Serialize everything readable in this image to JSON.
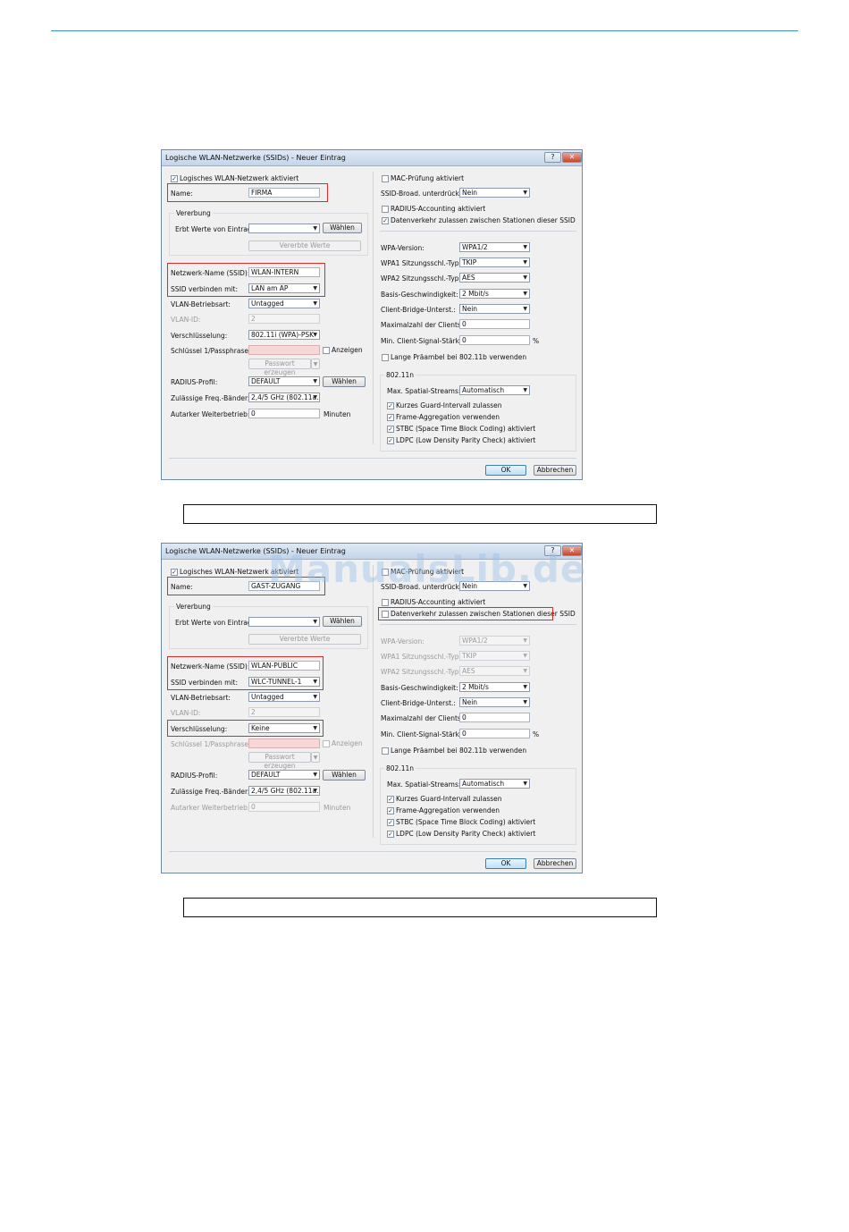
{
  "dialogs": [
    {
      "title": "Logische WLAN-Netzwerke (SSIDs) - Neuer Eintrag",
      "help_glyph": "?",
      "close_glyph": "✕",
      "left": {
        "active_label": "Logisches WLAN-Netzwerk aktiviert",
        "active_checked": "✓",
        "name_label": "Name:",
        "name_value": "FIRMA",
        "inherit_group": "Vererbung",
        "inherit_label": "Erbt Werte von Eintrag:",
        "inherit_value": "",
        "choose_btn": "Wählen",
        "inherited_btn": "Vererbte Werte",
        "ssid_label": "Netzwerk-Name (SSID):",
        "ssid_value": "WLAN-INTERN",
        "connect_label": "SSID verbinden mit:",
        "connect_value": "LAN am AP",
        "vlan_mode_label": "VLAN-Betriebsart:",
        "vlan_mode_value": "Untagged",
        "vlan_id_label": "VLAN-ID:",
        "vlan_id_value": "2",
        "enc_label": "Verschlüsselung:",
        "enc_value": "802.11i (WPA)-PSK",
        "key_label": "Schlüssel 1/Passphrase:",
        "show_label": "Anzeigen",
        "pw_btn": "Passwort erzeugen",
        "radius_label": "RADIUS-Profil:",
        "radius_value": "DEFAULT",
        "radius_btn": "Wählen",
        "bands_label": "Zulässige Freq.-Bänder:",
        "bands_value": "2,4/5 GHz (802.11a...",
        "autark_label": "Autarker Weiterbetrieb:",
        "autark_value": "0",
        "autark_unit": "Minuten"
      },
      "right": {
        "mac_label": "MAC-Prüfung aktiviert",
        "mac_checked": "",
        "broadcast_label": "SSID-Broad. unterdrücken:",
        "broadcast_value": "Nein",
        "radius_acc_label": "RADIUS-Accounting aktiviert",
        "radius_acc_checked": "",
        "traffic_label": "Datenverkehr zulassen zwischen Stationen dieser SSID",
        "traffic_checked": "✓",
        "wpa_version_label": "WPA-Version:",
        "wpa_version_value": "WPA1/2",
        "wpa1_label": "WPA1 Sitzungsschl.-Typ:",
        "wpa1_value": "TKIP",
        "wpa2_label": "WPA2 Sitzungsschl.-Typ:",
        "wpa2_value": "AES",
        "basis_label": "Basis-Geschwindigkeit:",
        "basis_value": "2 Mbit/s",
        "bridge_label": "Client-Bridge-Unterst.:",
        "bridge_value": "Nein",
        "max_clients_label": "Maximalzahl der Clients:",
        "max_clients_value": "0",
        "min_signal_label": "Min. Client-Signal-Stärke:",
        "min_signal_value": "0",
        "min_signal_unit": "%",
        "preamble_label": "Lange Präambel bei 802.11b verwenden",
        "preamble_checked": "",
        "n_group": "802.11n",
        "streams_label": "Max. Spatial-Streams:",
        "streams_value": "Automatisch",
        "guard_label": "Kurzes Guard-Intervall zulassen",
        "frame_label": "Frame-Aggregation verwenden",
        "stbc_label": "STBC (Space Time Block Coding) aktiviert",
        "ldpc_label": "LDPC (Low Density Parity Check) aktiviert",
        "n_checked": "✓"
      },
      "ok_btn": "OK",
      "cancel_btn": "Abbrechen"
    },
    {
      "title": "Logische WLAN-Netzwerke (SSIDs) - Neuer Eintrag",
      "help_glyph": "?",
      "close_glyph": "✕",
      "left": {
        "active_label": "Logisches WLAN-Netzwerk aktiviert",
        "active_checked": "✓",
        "name_label": "Name:",
        "name_value": "GAST-ZUGANG",
        "inherit_group": "Vererbung",
        "inherit_label": "Erbt Werte von Eintrag:",
        "inherit_value": "",
        "choose_btn": "Wählen",
        "inherited_btn": "Vererbte Werte",
        "ssid_label": "Netzwerk-Name (SSID):",
        "ssid_value": "WLAN-PUBLIC",
        "connect_label": "SSID verbinden mit:",
        "connect_value": "WLC-TUNNEL-1",
        "vlan_mode_label": "VLAN-Betriebsart:",
        "vlan_mode_value": "Untagged",
        "vlan_id_label": "VLAN-ID:",
        "vlan_id_value": "2",
        "enc_label": "Verschlüsselung:",
        "enc_value": "Keine",
        "key_label": "Schlüssel 1/Passphrase:",
        "show_label": "Anzeigen",
        "pw_btn": "Passwort erzeugen",
        "radius_label": "RADIUS-Profil:",
        "radius_value": "DEFAULT",
        "radius_btn": "Wählen",
        "bands_label": "Zulässige Freq.-Bänder:",
        "bands_value": "2,4/5 GHz (802.11a...",
        "autark_label": "Autarker Weiterbetrieb:",
        "autark_value": "0",
        "autark_unit": "Minuten"
      },
      "right": {
        "mac_label": "MAC-Prüfung aktiviert",
        "mac_checked": "",
        "broadcast_label": "SSID-Broad. unterdrücken:",
        "broadcast_value": "Nein",
        "radius_acc_label": "RADIUS-Accounting aktiviert",
        "radius_acc_checked": "",
        "traffic_label": "Datenverkehr zulassen zwischen Stationen dieser SSID",
        "traffic_checked": "",
        "wpa_version_label": "WPA-Version:",
        "wpa_version_value": "WPA1/2",
        "wpa1_label": "WPA1 Sitzungsschl.-Typ:",
        "wpa1_value": "TKIP",
        "wpa2_label": "WPA2 Sitzungsschl.-Typ:",
        "wpa2_value": "AES",
        "basis_label": "Basis-Geschwindigkeit:",
        "basis_value": "2 Mbit/s",
        "bridge_label": "Client-Bridge-Unterst.:",
        "bridge_value": "Nein",
        "max_clients_label": "Maximalzahl der Clients:",
        "max_clients_value": "0",
        "min_signal_label": "Min. Client-Signal-Stärke:",
        "min_signal_value": "0",
        "min_signal_unit": "%",
        "preamble_label": "Lange Präambel bei 802.11b verwenden",
        "preamble_checked": "",
        "n_group": "802.11n",
        "streams_label": "Max. Spatial-Streams:",
        "streams_value": "Automatisch",
        "guard_label": "Kurzes Guard-Intervall zulassen",
        "frame_label": "Frame-Aggregation verwenden",
        "stbc_label": "STBC (Space Time Block Coding) aktiviert",
        "ldpc_label": "LDPC (Low Density Parity Check) aktiviert",
        "n_checked": "✓"
      },
      "ok_btn": "OK",
      "cancel_btn": "Abbrechen"
    }
  ],
  "watermark": "ManualsLib.de",
  "colors": {
    "highlight": "#d92b2b",
    "accent_rule": "#3a8fd0",
    "watermark": "#9cc3ea"
  }
}
